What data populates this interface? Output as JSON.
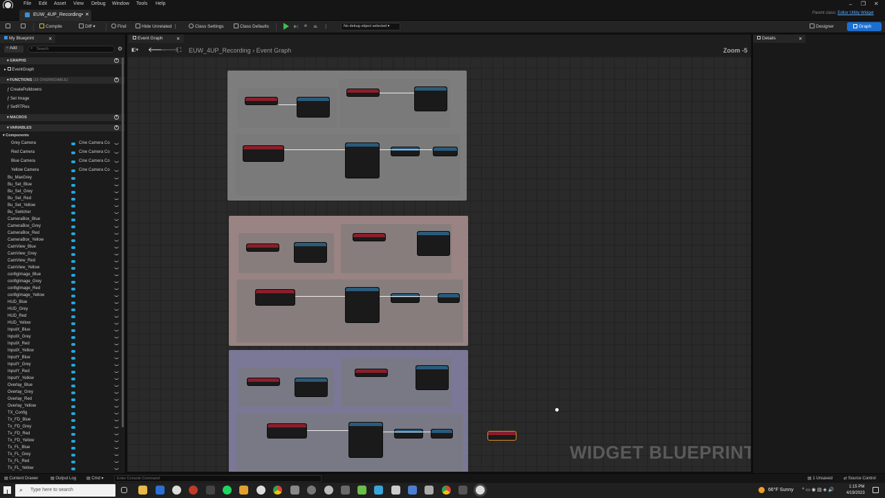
{
  "menu": [
    "File",
    "Edit",
    "Asset",
    "View",
    "Debug",
    "Window",
    "Tools",
    "Help"
  ],
  "tab": {
    "title": "EUW_4UP_Recording•"
  },
  "window": {
    "parent_class_label": "Parent class:",
    "parent_class_value": "Editor Utility Widget"
  },
  "toolbar": {
    "compile": "Compile",
    "diff": "Diff",
    "find": "Find",
    "hide_unrelated": "Hide Unrelated",
    "class_settings": "Class Settings",
    "class_defaults": "Class Defaults",
    "debug_select": "No debug object selected",
    "designer": "Designer",
    "graph": "Graph"
  },
  "my_blueprint": {
    "tab_label": "My Blueprint",
    "add_label": "Add",
    "search_placeholder": "Search",
    "sections": {
      "graphs": "GRAPHS",
      "functions": "FUNCTIONS",
      "functions_note": "(16 OVERRIDABLE)",
      "macros": "MACROS",
      "variables": "VARIABLES"
    },
    "graphs": [
      "EventGraph"
    ],
    "functions": [
      "CreatePulldowns",
      "Set Image",
      "SetRTRes"
    ],
    "components_label": "Components",
    "components": [
      {
        "name": "Grey Camera",
        "type": "Cine Camera Co"
      },
      {
        "name": "Red Camera",
        "type": "Cine Camera Co"
      },
      {
        "name": "Blue Camera",
        "type": "Cine Camera Co"
      },
      {
        "name": "Yellow Camera",
        "type": "Cine Camera Co"
      }
    ],
    "variables": [
      "Bu_MaxGrey",
      "Bu_Set_Blue",
      "Bu_Set_Grey",
      "Bu_Set_Red",
      "Bu_Set_Yellow",
      "Bu_Switcher",
      "CameraBox_Blue",
      "CameraBox_Grey",
      "CameraBox_Red",
      "CameraBox_Yellow",
      "CamView_Blue",
      "CamView_Grey",
      "CamView_Red",
      "CamView_Yellow",
      "configImage_Blue",
      "configImage_Grey",
      "configImage_Red",
      "configImage_Yellow",
      "HUD_Blue",
      "HUD_Grey",
      "HUD_Red",
      "HUD_Yellow",
      "InputX_Blue",
      "InputX_Grey",
      "InputX_Red",
      "InputX_Yellow",
      "InputY_Blue",
      "InputY_Grey",
      "InputY_Red",
      "InputY_Yellow",
      "Overlay_Blue",
      "Overlay_Grey",
      "Overlay_Red",
      "Overlay_Yellow",
      "TX_Config",
      "Tx_FD_Blue",
      "Tx_FD_Grey",
      "Tx_FD_Red",
      "Tx_FD_Yellow",
      "Tx_FL_Blue",
      "Tx_FL_Grey",
      "Tx_FL_Red",
      "Tx_FL_Yellow"
    ]
  },
  "graph": {
    "tab_label": "Event Graph",
    "breadcrumb_root": "EUW_4UP_Recording",
    "breadcrumb_sep": "›",
    "breadcrumb_leaf": "Event Graph",
    "zoom": "Zoom -5",
    "watermark": "WIDGET BLUEPRINT"
  },
  "details": {
    "tab_label": "Details"
  },
  "statusbar": {
    "content_drawer": "Content Drawer",
    "output_log": "Output Log",
    "cmd": "Cmd",
    "console_placeholder": "Enter Console Command",
    "unsaved": "1 Unsaved",
    "source_control": "Source Control"
  },
  "taskbar": {
    "search_placeholder": "Type here to search",
    "weather": "66°F  Sunny",
    "time": "1:15 PM",
    "date": "4/19/2023"
  },
  "colors": {
    "accent": "#1c6fd1",
    "variable_pill": "#1fa9e0",
    "comment_grey": "#7d7d7d",
    "comment_red": "#9a8383",
    "comment_blue": "#7a7896"
  }
}
